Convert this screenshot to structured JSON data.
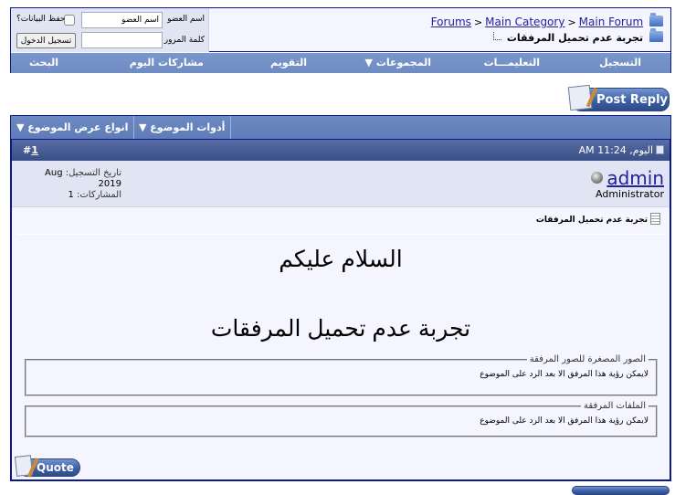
{
  "navbar": {
    "breadcrumb": [
      {
        "label": "Forums"
      },
      {
        "label": "Main Category"
      },
      {
        "label": "Main Forum"
      }
    ],
    "breadcrumb_separator": ">",
    "thread_title": "تجربة عدم تحميل المرفقات",
    "login": {
      "username_label": "اسم العضو",
      "username_value": "اسم العضو",
      "password_label": "كلمة المرور",
      "password_value": "",
      "remember_label": "حفظ البيانات؟",
      "remember_checked": false,
      "login_button": "تسجيل الدخول"
    },
    "menu": [
      {
        "label": "التسجيل"
      },
      {
        "label": "التعليمـــات"
      },
      {
        "label": "المجموعات ▼"
      },
      {
        "label": "التقويم"
      },
      {
        "label": "مشاركات اليوم"
      },
      {
        "label": "البحث"
      }
    ]
  },
  "buttons": {
    "post_reply": "Post Reply",
    "quote": "Quote"
  },
  "thread_tools": {
    "tools": "أدوات الموضوع ▼",
    "display_modes": "انواع عرض الموضوع ▼"
  },
  "post": {
    "number_prefix": "#",
    "number": "1",
    "date": "اليوم, 11:24 AM",
    "username": "admin",
    "usertitle": "Administrator",
    "join_date_label": "تاريخ التسجيل:",
    "join_date": "Aug 2019",
    "posts_label": "المشاركات:",
    "posts": "1",
    "title": "تجربة عدم تحميل المرفقات",
    "message_lines": [
      "السلام عليكم",
      "تجربة عدم تحميل المرفقات"
    ],
    "attachments": [
      {
        "legend": "الصور المصغرة للصور المرفقة",
        "text": "لايمكن رؤية هذا المرفق الا بعد الرد على الموضوع"
      },
      {
        "legend": "الملفات المرفقة",
        "text": "لايمكن رؤية هذا المرفق الا بعد الرد على الموضوع"
      }
    ]
  },
  "colors": {
    "border": "#0b198c",
    "nav_bar": "#7390c8",
    "post_header": "#3a4f86",
    "panel": "#e1e4f2",
    "content_bg": "#f5f5ff",
    "link": "#22229c"
  }
}
